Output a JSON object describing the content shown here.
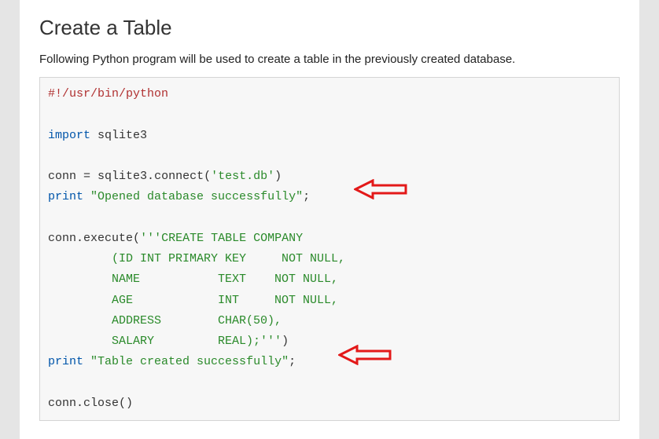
{
  "heading": "Create a Table",
  "intro": "Following Python program will be used to create a table in the previously created database.",
  "code": {
    "shebang": "#!/usr/bin/python",
    "import_kw": "import",
    "import_mod": " sqlite3",
    "conn_assign_pre": "conn ",
    "conn_assign_eq": "=",
    "conn_assign_post": " sqlite3",
    "conn_connect": ".",
    "connect_fn": "connect",
    "connect_open": "(",
    "connect_arg": "'test.db'",
    "connect_close": ")",
    "print1_kw": "print",
    "print1_sp": " ",
    "print1_str": "\"Opened database successfully\"",
    "print1_semi": ";",
    "execute_pre": "conn",
    "execute_dot": ".",
    "execute_fn": "execute",
    "execute_open": "(",
    "sql_line1": "'''CREATE TABLE COMPANY",
    "sql_line2": "         (ID INT PRIMARY KEY     NOT NULL,",
    "sql_line3": "         NAME           TEXT    NOT NULL,",
    "sql_line4": "         AGE            INT     NOT NULL,",
    "sql_line5": "         ADDRESS        CHAR(50),",
    "sql_line6": "         SALARY         REAL);'''",
    "execute_close": ")",
    "print2_kw": "print",
    "print2_sp": " ",
    "print2_str": "\"Table created successfully\"",
    "print2_semi": ";",
    "close_pre": "conn",
    "close_dot": ".",
    "close_fn": "close",
    "close_parens": "()"
  },
  "arrow_color": "#e31919"
}
